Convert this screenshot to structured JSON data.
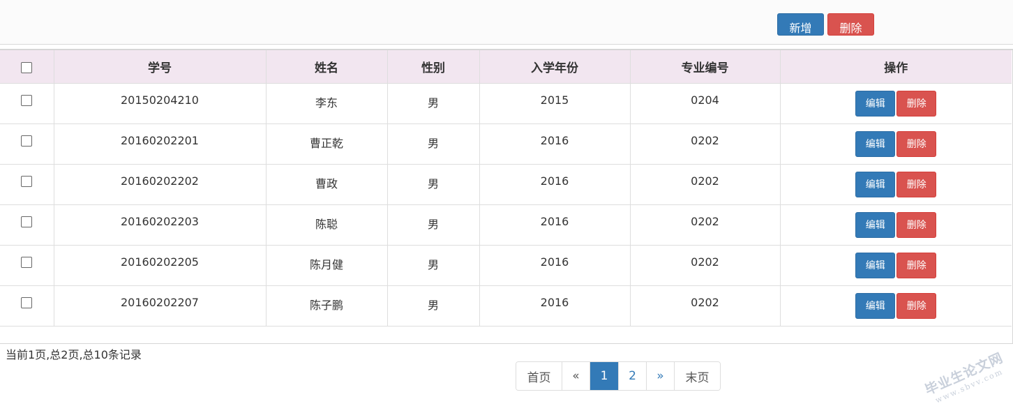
{
  "toolbar": {
    "add_label": "新增",
    "delete_label": "删除"
  },
  "table": {
    "headers": [
      "学号",
      "姓名",
      "性别",
      "入学年份",
      "专业编号",
      "操作"
    ],
    "rows": [
      {
        "id": "20150204210",
        "name": "李东",
        "gender": "男",
        "year": "2015",
        "major": "0204"
      },
      {
        "id": "20160202201",
        "name": "曹正乾",
        "gender": "男",
        "year": "2016",
        "major": "0202"
      },
      {
        "id": "20160202202",
        "name": "曹政",
        "gender": "男",
        "year": "2016",
        "major": "0202"
      },
      {
        "id": "20160202203",
        "name": "陈聪",
        "gender": "男",
        "year": "2016",
        "major": "0202"
      },
      {
        "id": "20160202205",
        "name": "陈月健",
        "gender": "男",
        "year": "2016",
        "major": "0202"
      },
      {
        "id": "20160202207",
        "name": "陈子鹏",
        "gender": "男",
        "year": "2016",
        "major": "0202"
      }
    ],
    "edit_label": "编辑",
    "delete_label": "删除"
  },
  "summary": "当前1页,总2页,总10条记录",
  "pagination": {
    "first": "首页",
    "prev": "«",
    "pages": [
      "1",
      "2"
    ],
    "current": "1",
    "next": "»",
    "last": "末页"
  },
  "watermark": {
    "line1": "毕业生论文网",
    "line2": "www.sbvv.com"
  },
  "colors": {
    "primary": "#337ab7",
    "danger": "#d9534f",
    "header_bg": "#f2e6f0"
  }
}
